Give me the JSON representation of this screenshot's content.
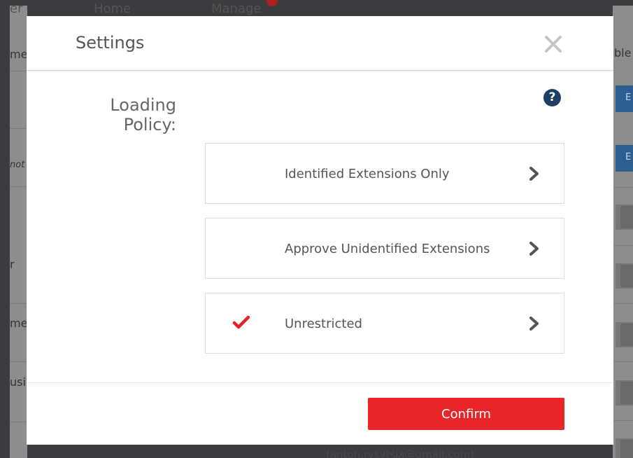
{
  "background": {
    "nav": {
      "left_text": "er",
      "home": "Home",
      "manage": "Manage"
    },
    "left_fragments": [
      "me",
      "not",
      "r",
      "me",
      "usi"
    ],
    "right_fragments": {
      "text": "ble",
      "button_text": "E"
    },
    "bottom_text": "(anton.rysytsia@gmail.com)"
  },
  "modal": {
    "title": "Settings",
    "close_icon": "close-icon",
    "help_icon": "question-icon",
    "policy_label": "Loading Policy:",
    "options": [
      {
        "label": "Identified Extensions Only",
        "selected": false
      },
      {
        "label": "Approve Unidentified Extensions",
        "selected": false
      },
      {
        "label": "Unrestricted",
        "selected": true
      }
    ],
    "confirm_label": "Confirm",
    "colors": {
      "confirm_bg": "#e8262a",
      "check": "#e0242a",
      "help_bg": "#1d3f66",
      "chevron": "#555555"
    }
  }
}
